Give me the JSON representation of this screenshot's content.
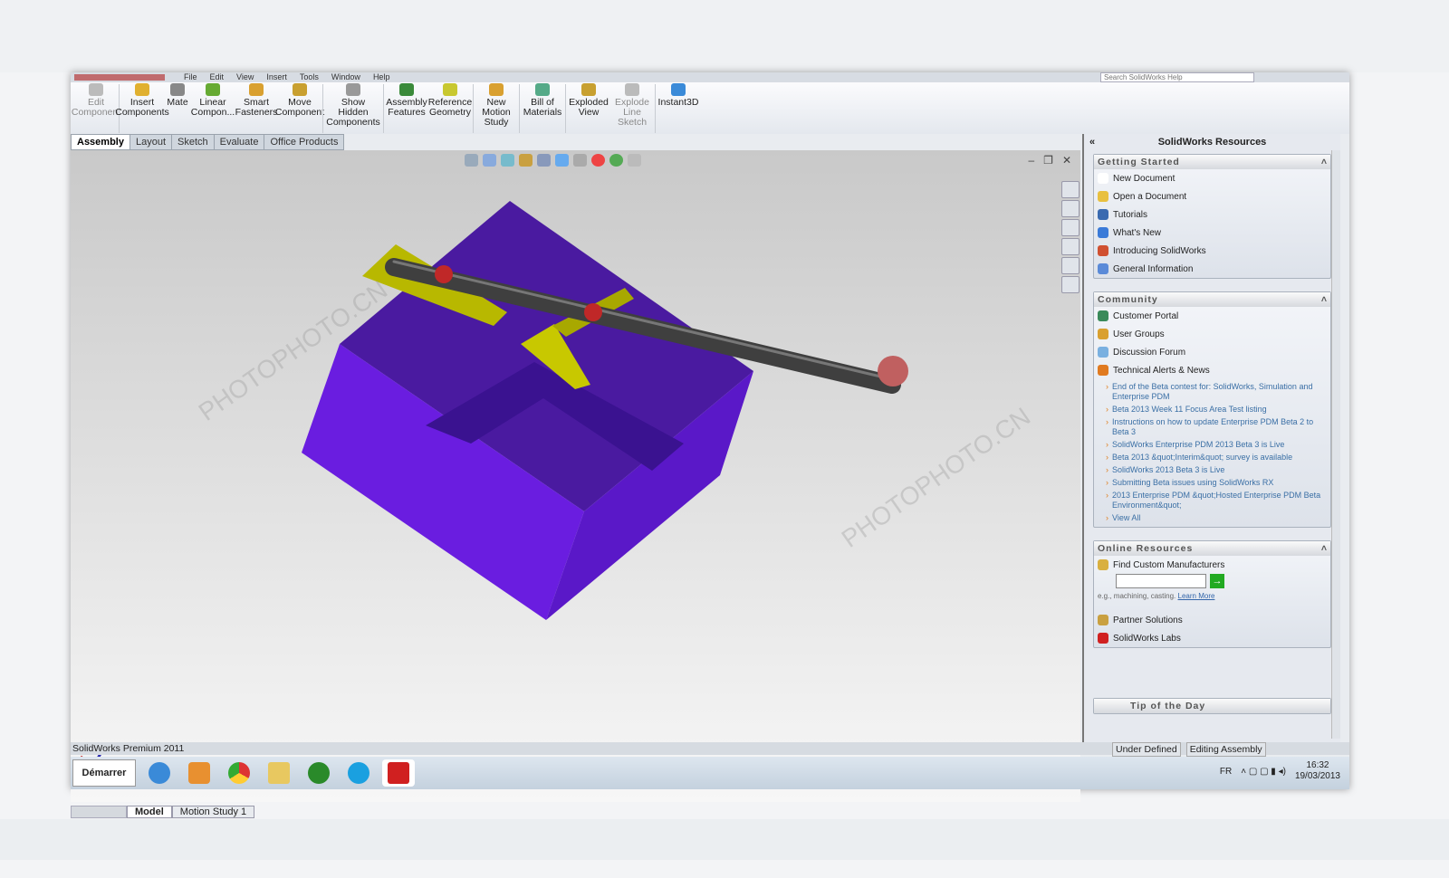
{
  "app": {
    "title": "SolidWorks",
    "menu": [
      "File",
      "Edit",
      "View",
      "Insert",
      "Tools",
      "Window",
      "Help"
    ],
    "search_placeholder": "Search SolidWorks Help"
  },
  "ribbon": [
    {
      "label": "Edit Component",
      "icon": "edit-component-icon",
      "enabled": false
    },
    {
      "label": "Insert Components",
      "icon": "insert-components-icon",
      "enabled": true
    },
    {
      "label": "Mate",
      "icon": "mate-icon",
      "enabled": true
    },
    {
      "label": "Linear Compon...",
      "icon": "linear-pattern-icon",
      "enabled": true
    },
    {
      "label": "Smart Fasteners",
      "icon": "smart-fasteners-icon",
      "enabled": true
    },
    {
      "label": "Move Component",
      "icon": "move-component-icon",
      "enabled": true
    },
    {
      "label": "Show Hidden Components",
      "icon": "show-hidden-icon",
      "enabled": true
    },
    {
      "label": "Assembly Features",
      "icon": "assembly-features-icon",
      "enabled": true
    },
    {
      "label": "Reference Geometry",
      "icon": "reference-geometry-icon",
      "enabled": true
    },
    {
      "label": "New Motion Study",
      "icon": "motion-study-icon",
      "enabled": true
    },
    {
      "label": "Bill of Materials",
      "icon": "bom-icon",
      "enabled": true
    },
    {
      "label": "Exploded View",
      "icon": "exploded-view-icon",
      "enabled": true
    },
    {
      "label": "Explode Line Sketch",
      "icon": "explode-line-icon",
      "enabled": false
    },
    {
      "label": "Instant3D",
      "icon": "instant3d-icon",
      "enabled": true
    }
  ],
  "tabs": [
    "Assembly",
    "Layout",
    "Sketch",
    "Evaluate",
    "Office Products"
  ],
  "active_tab": "Assembly",
  "bottom_tabs": [
    "Model",
    "Motion Study 1"
  ],
  "status": {
    "app": "SolidWorks Premium 2011",
    "state": "Under Defined",
    "mode": "Editing Assembly"
  },
  "panel": {
    "title": "SolidWorks Resources",
    "getting_started": {
      "title": "Getting Started",
      "items": [
        "New Document",
        "Open a Document",
        "Tutorials",
        "What's New",
        "Introducing SolidWorks",
        "General Information"
      ]
    },
    "community": {
      "title": "Community",
      "items": [
        "Customer Portal",
        "User Groups",
        "Discussion Forum",
        "Technical Alerts & News"
      ],
      "news": [
        "End of the Beta contest for: SolidWorks, Simulation and Enterprise PDM",
        "Beta 2013 Week 11 Focus Area Test listing",
        "Instructions on how to update Enterprise PDM Beta 2 to Beta 3",
        "SolidWorks Enterprise PDM 2013 Beta 3 is Live",
        "Beta 2013 &quot;Interim&quot; survey is available",
        "SolidWorks 2013 Beta 3 is Live",
        "Submitting Beta issues using SolidWorks RX",
        "2013 Enterprise PDM &quot;Hosted Enterprise PDM Beta Environment&quot;"
      ],
      "view_all": "View All"
    },
    "online": {
      "title": "Online Resources",
      "find": "Find Custom Manufacturers",
      "hint": "e.g., machining, casting.",
      "learn": "Learn More",
      "items": [
        "Partner Solutions",
        "SolidWorks Labs"
      ]
    },
    "tip": "Tip of the Day"
  },
  "taskbar": {
    "start": "Démarrer",
    "lang": "FR",
    "time": "16:32",
    "date": "19/03/2013"
  },
  "watermark": "PHOTOPHOTO.CN",
  "colors": {
    "box_top": "#4a1aa0",
    "box_left": "#6a1de0",
    "slider": "#b8b800",
    "bar": "#404040",
    "ball": "#c04040"
  }
}
